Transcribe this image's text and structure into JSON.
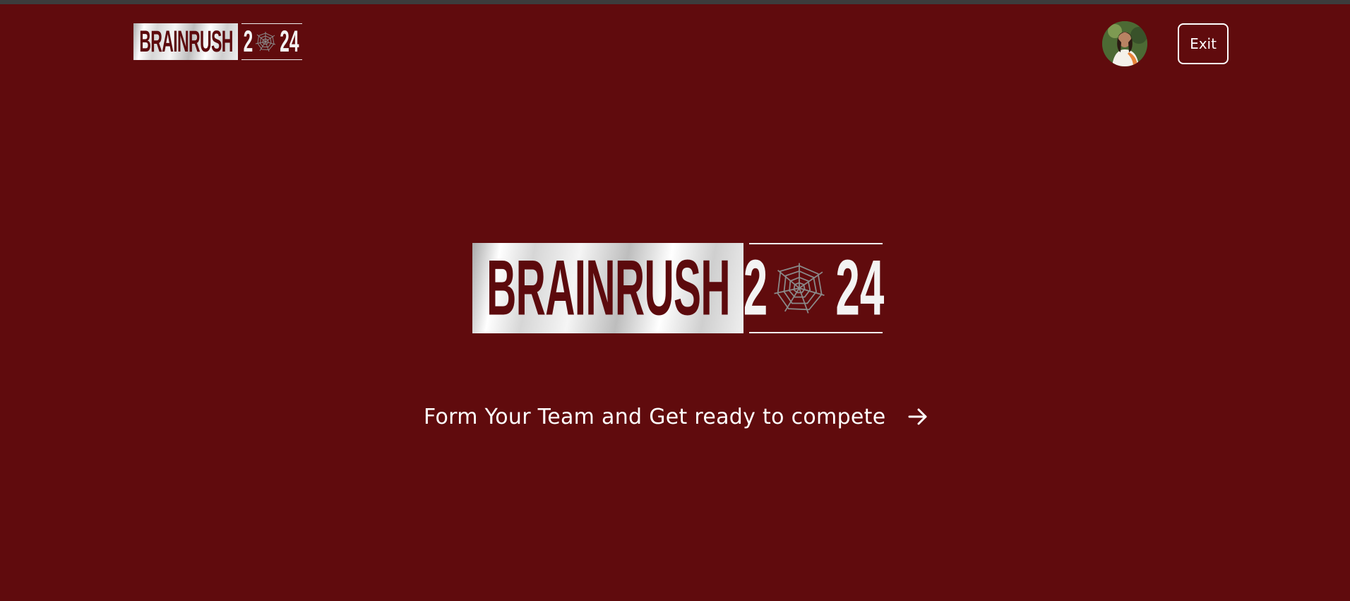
{
  "brand": {
    "name": "BRAINRUSH",
    "year_left": "2",
    "year_right": "24",
    "web_icon": "spider-web-icon"
  },
  "header": {
    "avatar_icon": "user-avatar",
    "exit_label": "Exit"
  },
  "hero": {
    "cta_label": "Form Your Team and Get ready to compete",
    "cta_icon": "arrow-right-icon"
  },
  "colors": {
    "background": "#600b0d",
    "accent": "#ffffff",
    "logo_red": "#5c0a0d"
  }
}
